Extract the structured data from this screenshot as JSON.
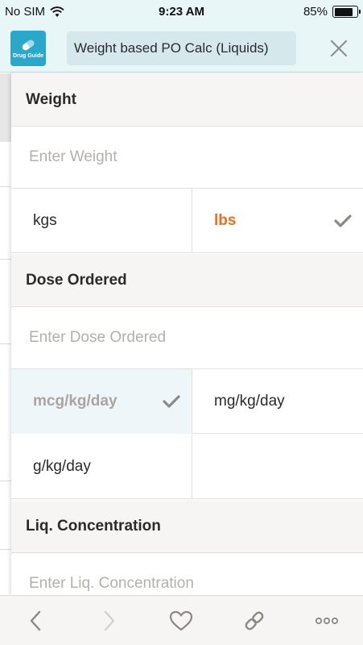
{
  "status_bar": {
    "carrier": "No SIM",
    "time": "9:23 AM",
    "battery_percent": "85%",
    "battery_level": 0.85
  },
  "header": {
    "logo_label": "Drug Guide",
    "title": "Weight based PO Calc (Liquids)",
    "close_icon": "close-icon"
  },
  "form": {
    "weight": {
      "header": "Weight",
      "placeholder": "Enter Weight",
      "units": [
        {
          "label": "kgs",
          "selected": false
        },
        {
          "label": "lbs",
          "selected": true
        }
      ]
    },
    "dose": {
      "header": "Dose Ordered",
      "placeholder": "Enter Dose Ordered",
      "units": [
        {
          "label": "mcg/kg/day",
          "selected": true
        },
        {
          "label": "mg/kg/day",
          "selected": false
        },
        {
          "label": "g/kg/day",
          "selected": false
        }
      ]
    },
    "concentration": {
      "header": "Liq. Concentration",
      "placeholder": "Enter Liq. Concentration"
    }
  },
  "toolbar": {
    "icons": [
      "chevron-left-icon",
      "chevron-right-icon",
      "heart-icon",
      "link-icon",
      "more-icon"
    ]
  },
  "colors": {
    "accent_orange": "#f16b1d",
    "header_bg": "#e9f6f8",
    "logo_blue": "#2aa7c9",
    "selected_blue_bg": "#eef6f9",
    "check_gray": "#8c8882"
  }
}
